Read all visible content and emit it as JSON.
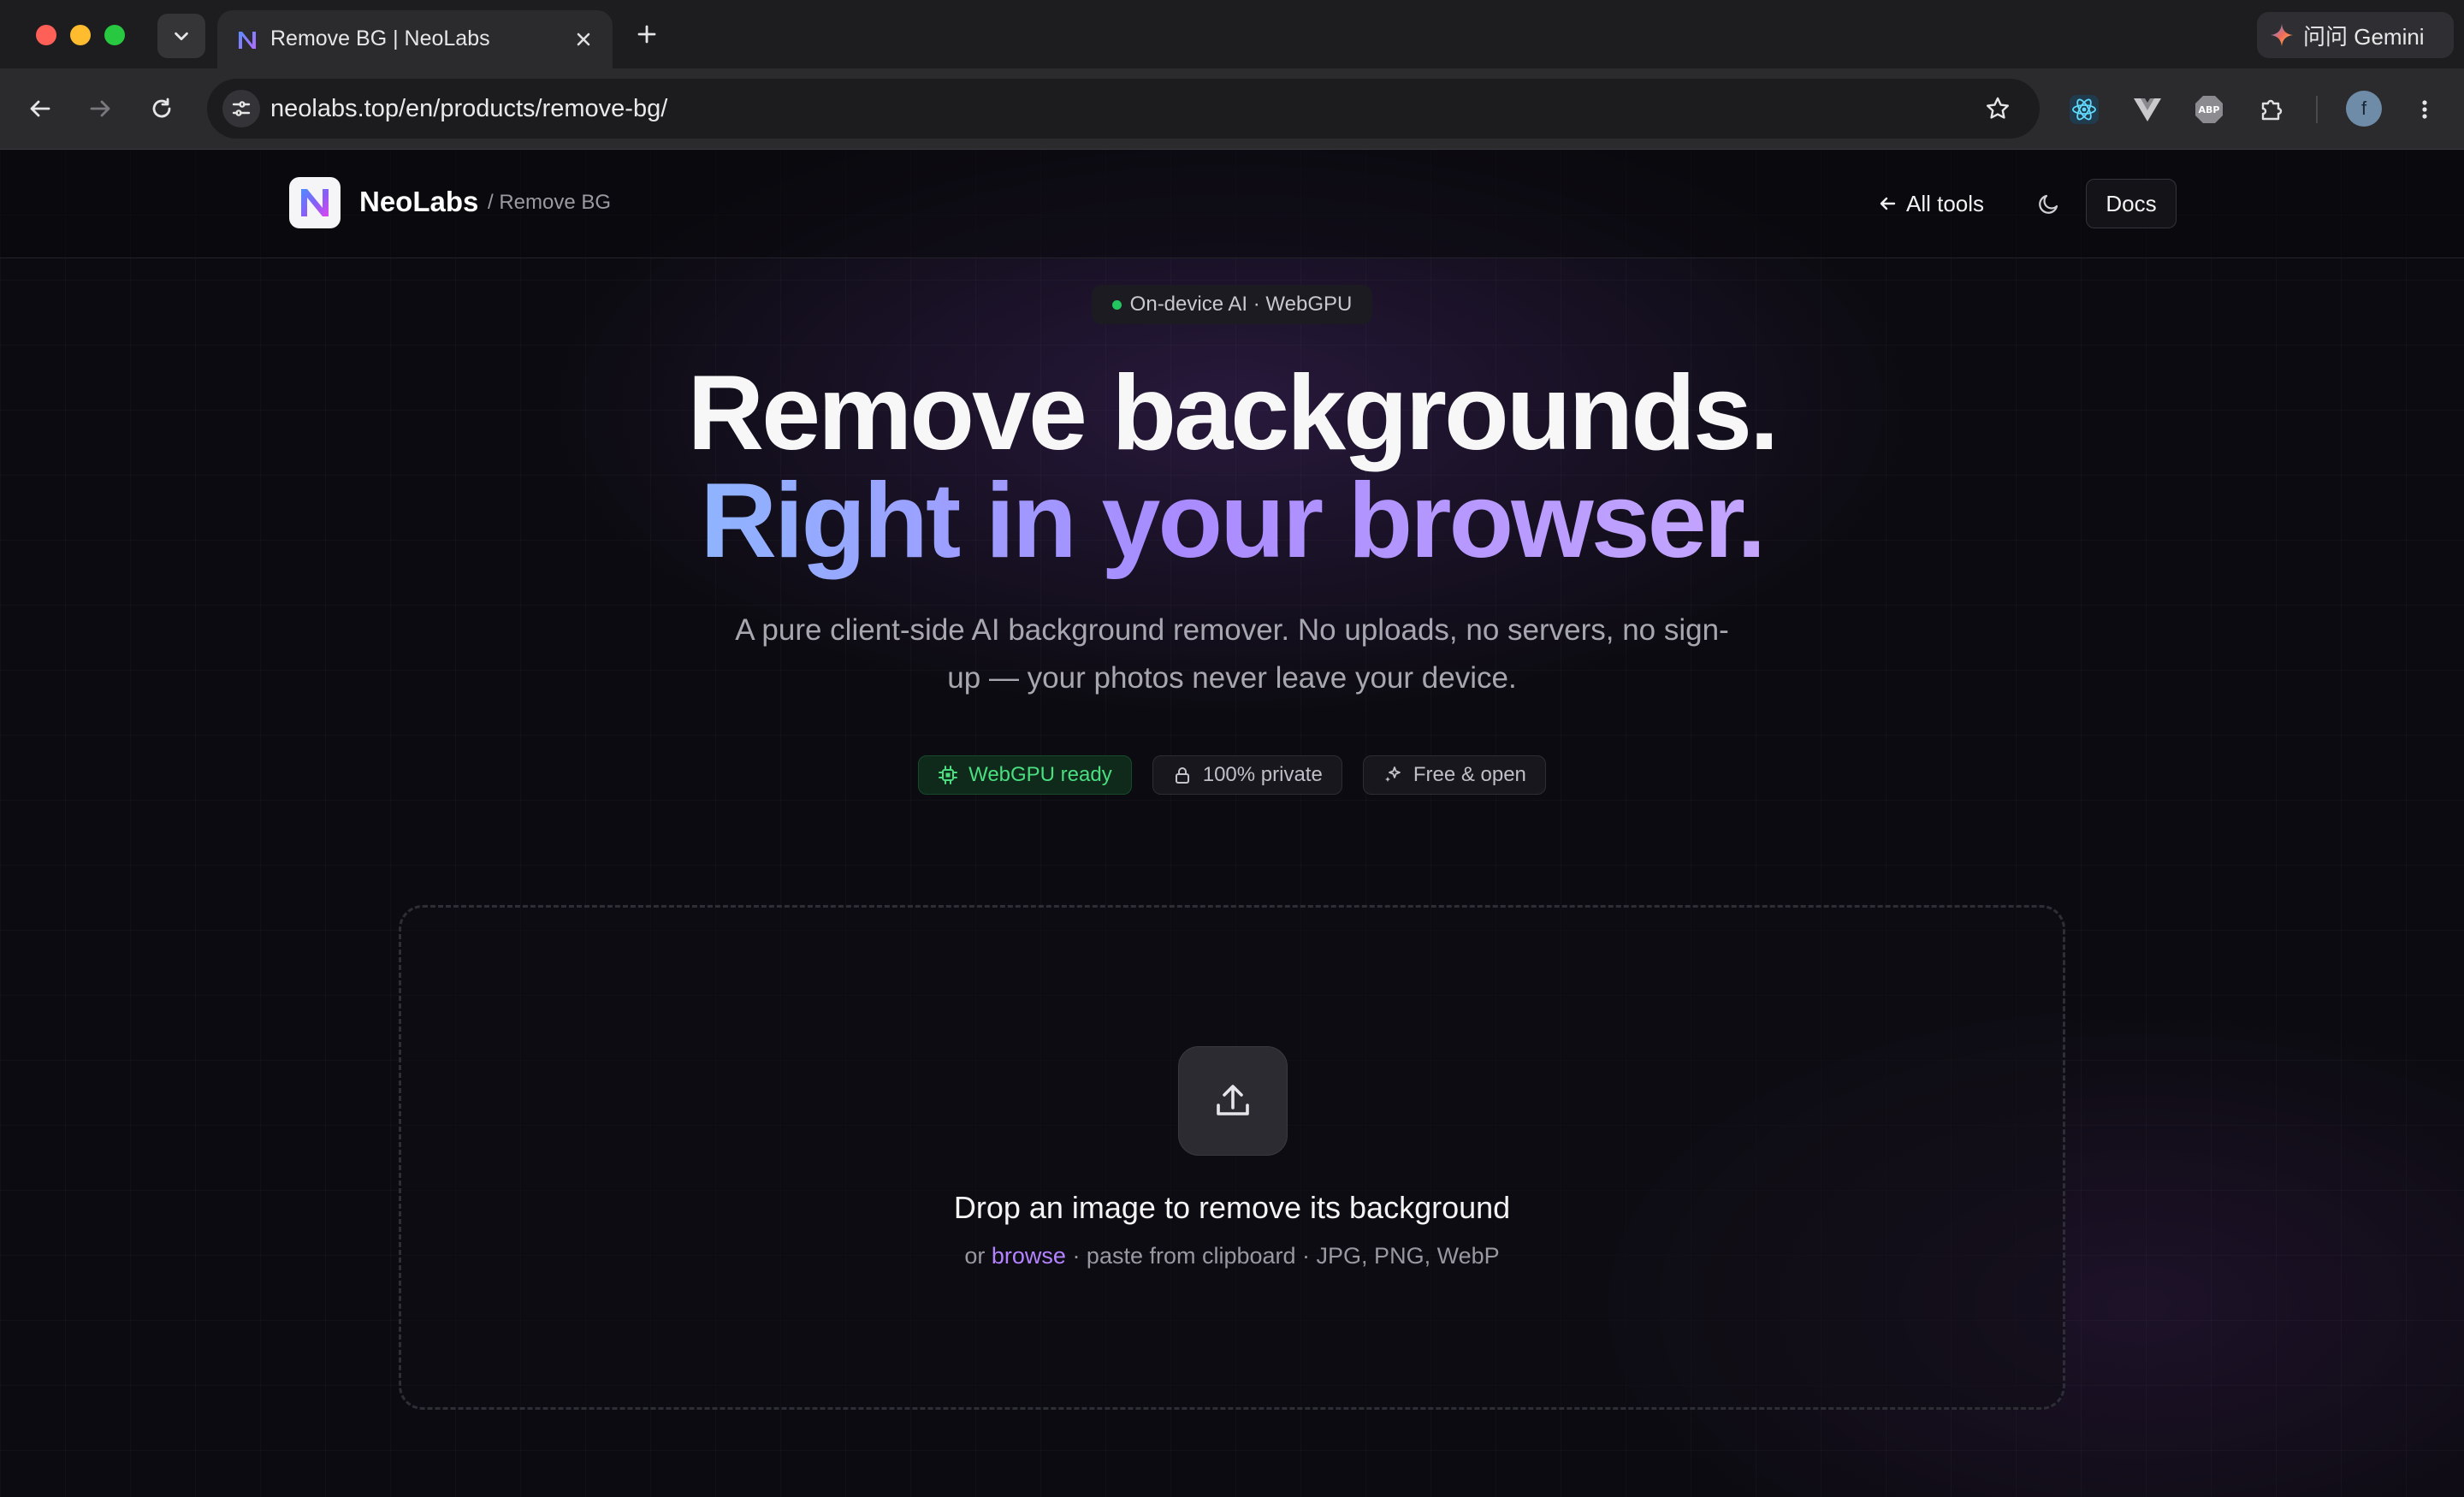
{
  "browser": {
    "tab": {
      "title": "Remove BG | NeoLabs"
    },
    "url": "neolabs.top/en/products/remove-bg/",
    "gemini_label": "问问 Gemini",
    "profile_initial": "f",
    "extensions": [
      "react-devtools-icon",
      "vue-devtools-icon",
      "adblock-plus-icon",
      "puzzle-icon"
    ]
  },
  "header": {
    "brand": "NeoLabs",
    "breadcrumb": "/ Remove BG",
    "all_tools_label": "All tools",
    "docs_label": "Docs"
  },
  "hero": {
    "pill": "On-device AI · WebGPU",
    "title_line1": "Remove backgrounds.",
    "title_line2": "Right in your browser.",
    "subtitle": "A pure client-side AI background remover. No uploads, no servers, no sign-up — your photos never leave your device.",
    "badges": {
      "webgpu": "WebGPU ready",
      "private": "100% private",
      "free": "Free & open"
    }
  },
  "dropzone": {
    "title": "Drop an image to remove its background",
    "hint_prefix": "or ",
    "browse": "browse",
    "hint_suffix": " · paste from clipboard · JPG, PNG, WebP"
  },
  "colors": {
    "accent_purple": "#b483ff",
    "gradient_start": "#8fb4ff",
    "gradient_end": "#c4a6ff",
    "status_green": "#22c55e",
    "page_bg": "#0c0b11"
  }
}
